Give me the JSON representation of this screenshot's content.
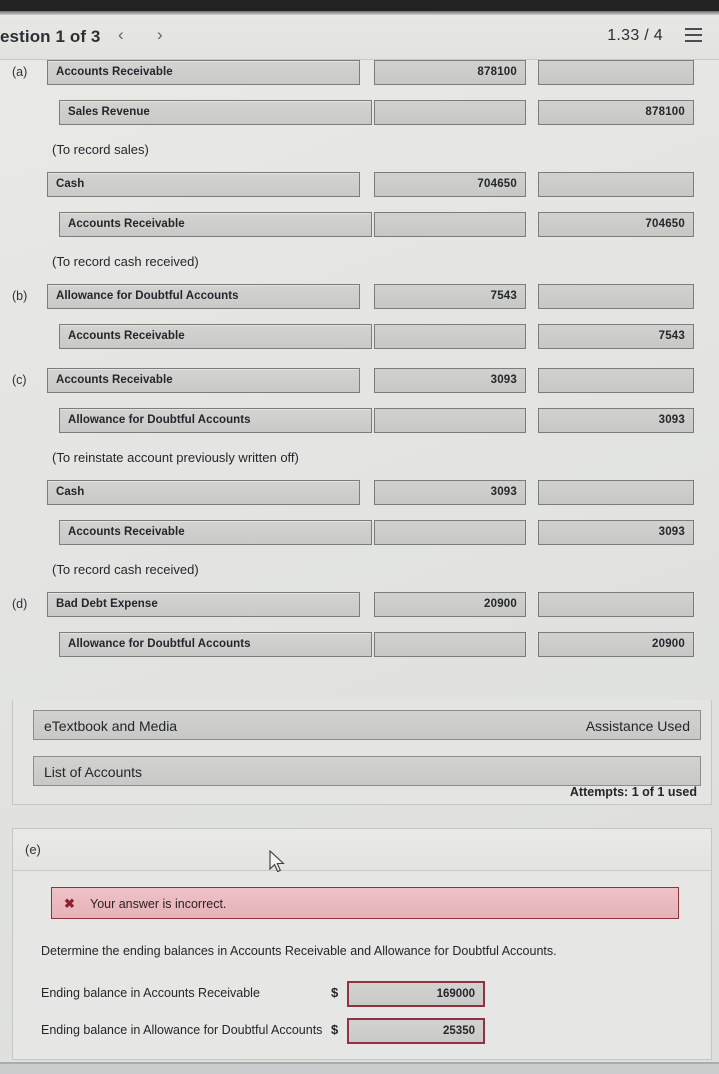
{
  "header": {
    "title": "estion 1 of 3",
    "prev_icon": "chevron-left-icon",
    "next_icon": "chevron-right-icon",
    "prev": "‹",
    "next": "›",
    "score": "1.33 / 4",
    "menu_icon": "list-menu-icon"
  },
  "journal": {
    "entries": [
      {
        "tag": "(a)",
        "lines": [
          {
            "account": "Accounts Receivable",
            "indent": 0,
            "debit": "878100",
            "credit": ""
          },
          {
            "account": "Sales Revenue",
            "indent": 12,
            "debit": "",
            "credit": "878100"
          }
        ],
        "memo": "(To record sales)"
      },
      {
        "tag": "",
        "lines": [
          {
            "account": "Cash",
            "indent": 0,
            "debit": "704650",
            "credit": ""
          },
          {
            "account": "Accounts Receivable",
            "indent": 12,
            "debit": "",
            "credit": "704650"
          }
        ],
        "memo": "(To record cash received)"
      },
      {
        "tag": "(b)",
        "lines": [
          {
            "account": "Allowance for Doubtful Accounts",
            "indent": 0,
            "debit": "7543",
            "credit": ""
          },
          {
            "account": "Accounts Receivable",
            "indent": 12,
            "debit": "",
            "credit": "7543"
          }
        ],
        "memo": ""
      },
      {
        "tag": "(c)",
        "lines": [
          {
            "account": "Accounts Receivable",
            "indent": 0,
            "debit": "3093",
            "credit": ""
          },
          {
            "account": "Allowance for Doubtful Accounts",
            "indent": 12,
            "debit": "",
            "credit": "3093"
          }
        ],
        "memo": "(To reinstate account previously written off)"
      },
      {
        "tag": "",
        "lines": [
          {
            "account": "Cash",
            "indent": 0,
            "debit": "3093",
            "credit": ""
          },
          {
            "account": "Accounts Receivable",
            "indent": 12,
            "debit": "",
            "credit": "3093"
          }
        ],
        "memo": "(To record cash received)"
      },
      {
        "tag": "(d)",
        "lines": [
          {
            "account": "Bad Debt Expense",
            "indent": 0,
            "debit": "20900",
            "credit": ""
          },
          {
            "account": "Allowance for Doubtful Accounts",
            "indent": 12,
            "debit": "",
            "credit": "20900"
          }
        ],
        "memo": ""
      }
    ]
  },
  "resources": {
    "etextbook_label": "eTextbook and Media",
    "assistance_label": "Assistance Used",
    "list_of_accounts_label": "List of Accounts",
    "attempts_label": "Attempts: 1 of 1 used"
  },
  "part_e": {
    "tag": "(e)",
    "error_icon": "x-mark-icon",
    "error_mark": "✖",
    "error_text": "Your answer is incorrect.",
    "prompt": "Determine the ending balances in Accounts Receivable and Allowance for Doubtful Accounts.",
    "balances": [
      {
        "label": "Ending balance in Accounts Receivable",
        "currency": "$",
        "value": "169000"
      },
      {
        "label": "Ending balance in Allowance for Doubtful Accounts",
        "currency": "$",
        "value": "25350"
      }
    ]
  },
  "colors": {
    "error_border": "#8e3440",
    "error_bg": "#e6b2b8",
    "field_bg": "#cbccc9",
    "page_bg": "#e4e5e2"
  }
}
